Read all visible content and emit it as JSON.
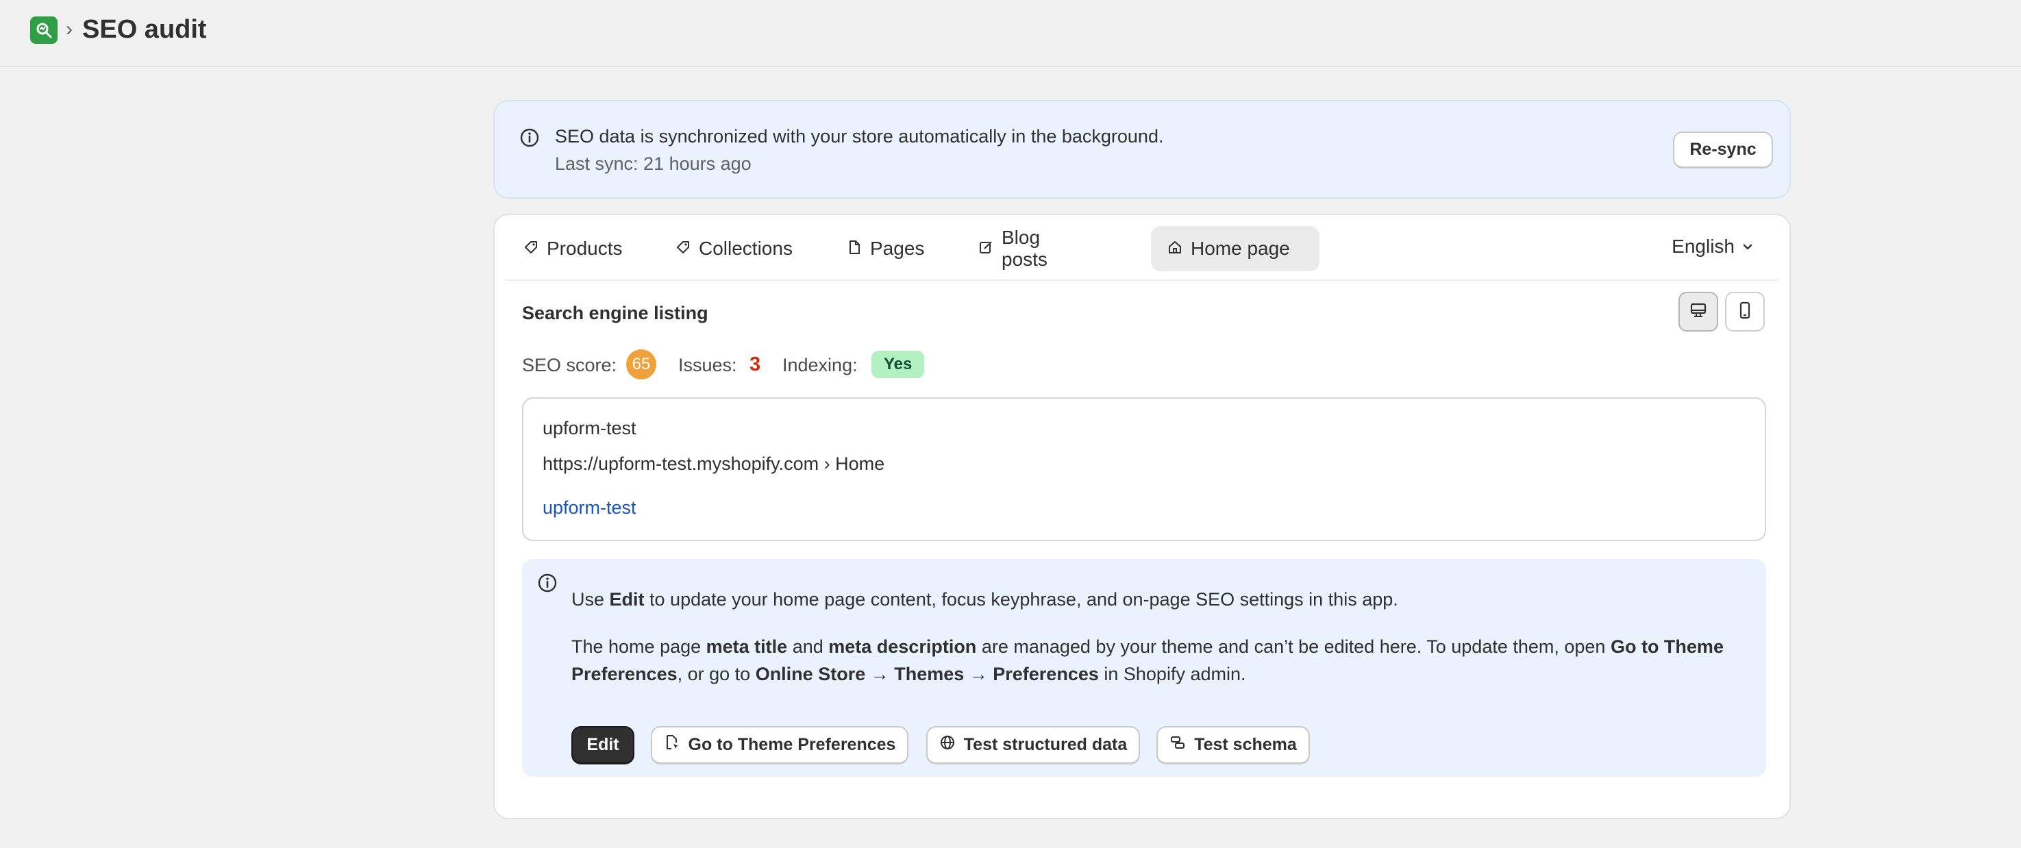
{
  "header": {
    "separator": "›",
    "title": "SEO audit"
  },
  "banner": {
    "message": "SEO data is synchronized with your store automatically in the background.",
    "last_sync": "Last sync: 21 hours ago",
    "resync_label": "Re-sync"
  },
  "tabs": [
    {
      "label": "Products",
      "icon": "tag-icon",
      "active": false
    },
    {
      "label": "Collections",
      "icon": "tag-icon",
      "active": false
    },
    {
      "label": "Pages",
      "icon": "page-icon",
      "active": false
    },
    {
      "label": "Blog posts",
      "icon": "edit-icon",
      "active": false
    },
    {
      "label": "Home page",
      "icon": "home-icon",
      "active": true
    }
  ],
  "language": "English",
  "listing": {
    "title": "Search engine listing",
    "view_mode": "desktop",
    "score_label": "SEO score:",
    "score_value": "65",
    "issues_label": "Issues:",
    "issues_value": "3",
    "indexing_label": "Indexing:",
    "indexing_value": "Yes"
  },
  "preview": {
    "site_name": "upform-test",
    "url": "https://upform-test.myshopify.com › Home",
    "title": "upform-test"
  },
  "info": {
    "p1_pre": "Use ",
    "p1_bold": "Edit",
    "p1_post": " to update your home page content, focus keyphrase, and on-page SEO settings in this app.",
    "p2_a": "The home page ",
    "p2_b": "meta title",
    "p2_c": " and ",
    "p2_d": "meta description",
    "p2_e": " are managed by your theme and can’t be edited here. To update them, open ",
    "p2_f": "Go to Theme Preferences",
    "p2_g": ", or go to ",
    "p2_h": "Online Store → Themes → Preferences",
    "p2_i": " in Shopify admin."
  },
  "actions": {
    "edit": "Edit",
    "theme": "Go to Theme Preferences",
    "structured": "Test structured data",
    "schema": "Test schema"
  },
  "colors": {
    "score_badge": "#f0a23a",
    "issues": "#d72c0d",
    "indexing_badge": "#b3f1c3",
    "link": "#1a56b8",
    "info_bg": "#eaf2fd"
  }
}
